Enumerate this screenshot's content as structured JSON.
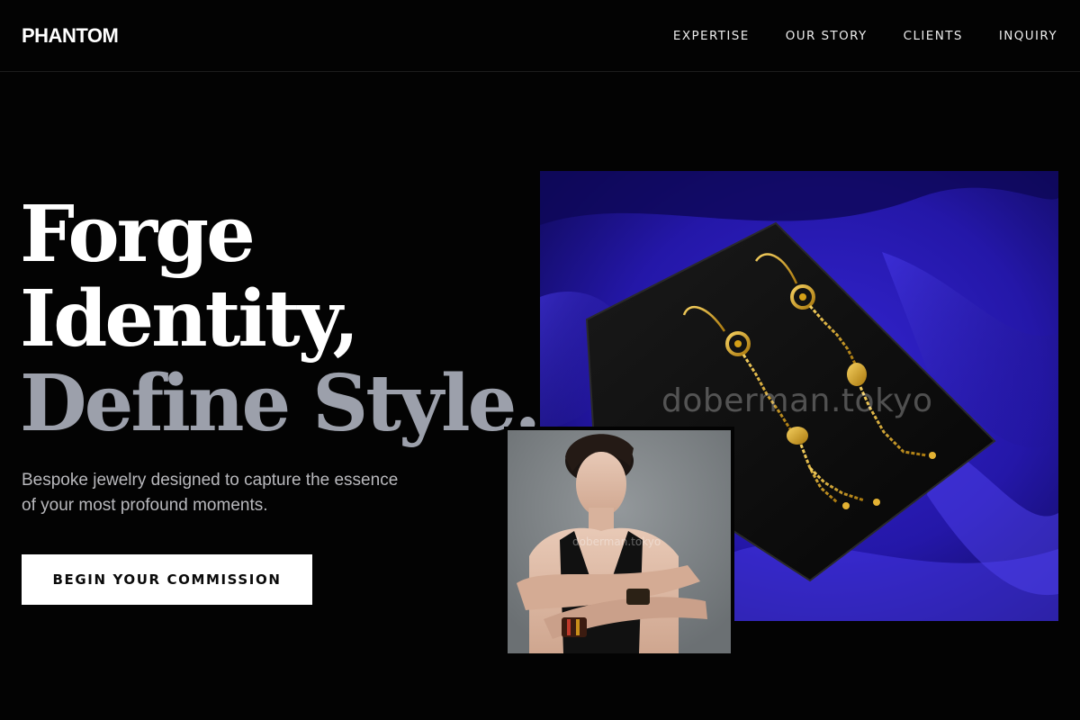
{
  "brand": {
    "logo": "PHANTOM"
  },
  "nav": [
    {
      "label": "EXPERTISE"
    },
    {
      "label": "OUR STORY"
    },
    {
      "label": "CLIENTS"
    },
    {
      "label": "INQUIRY"
    }
  ],
  "hero": {
    "headline_line1": "Forge",
    "headline_line2": "Identity,",
    "headline_line3": "Define Style.",
    "subcopy": "Bespoke jewelry designed to capture the essence of your most profound moments.",
    "cta_label": "BEGIN YOUR COMMISSION"
  },
  "images": {
    "main_watermark": "doberman.tokyo",
    "portrait_watermark": "doberman.tokyo"
  },
  "colors": {
    "background": "#030303",
    "headline_accent": "#9ca0ab",
    "velvet_blue": "#2a1bb5",
    "gold": "#d4a017"
  }
}
